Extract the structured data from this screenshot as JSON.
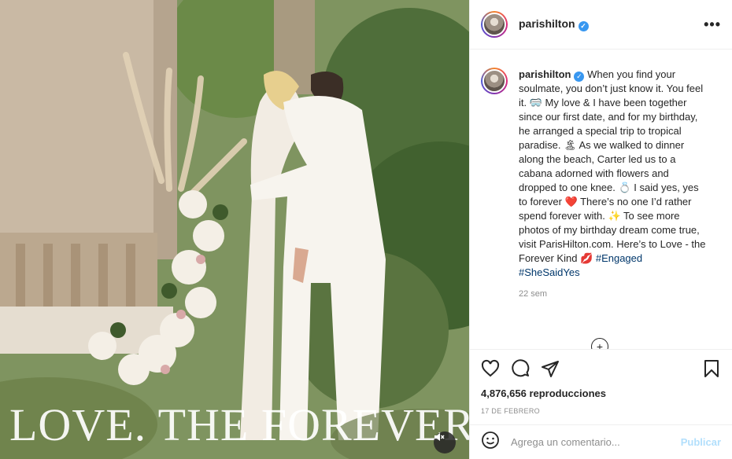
{
  "media": {
    "overlay_text": "LOVE. THE FOREVER KIND",
    "mute_icon": "speaker-muted-icon"
  },
  "header": {
    "username": "parishilton",
    "verified_icon": "verified-badge-icon",
    "more_icon": "more-options-icon",
    "more_label": "•••"
  },
  "caption": {
    "username": "parishilton",
    "text_1": "When you find your soulmate, you don’t just know it. You feel it. 🥽 My love & I have been together since our first date, and for my birthday, he arranged a special trip to tropical paradise. 🏝 As we walked to dinner along the beach, Carter led us to a cabana adorned with flowers and dropped to one knee. 💍 I said yes, yes to forever ❤️ There’s no one I’d rather spend forever with. ✨ To see more photos of my birthday dream come true, visit ParisHilton.com. Here’s to Love - the Forever Kind 💋 ",
    "hashtag_1": "#Engaged",
    "hashtag_2": "#SheSaidYes",
    "time": "22 sem"
  },
  "load_more": "+",
  "actions": {
    "like_icon": "heart-icon",
    "comment_icon": "comment-icon",
    "share_icon": "share-icon",
    "save_icon": "bookmark-icon",
    "views": "4,876,656 reproducciones",
    "date": "17 DE FEBRERO"
  },
  "add_comment": {
    "emoji_icon": "emoji-icon",
    "placeholder": "Agrega un comentario...",
    "post_label": "Publicar"
  }
}
